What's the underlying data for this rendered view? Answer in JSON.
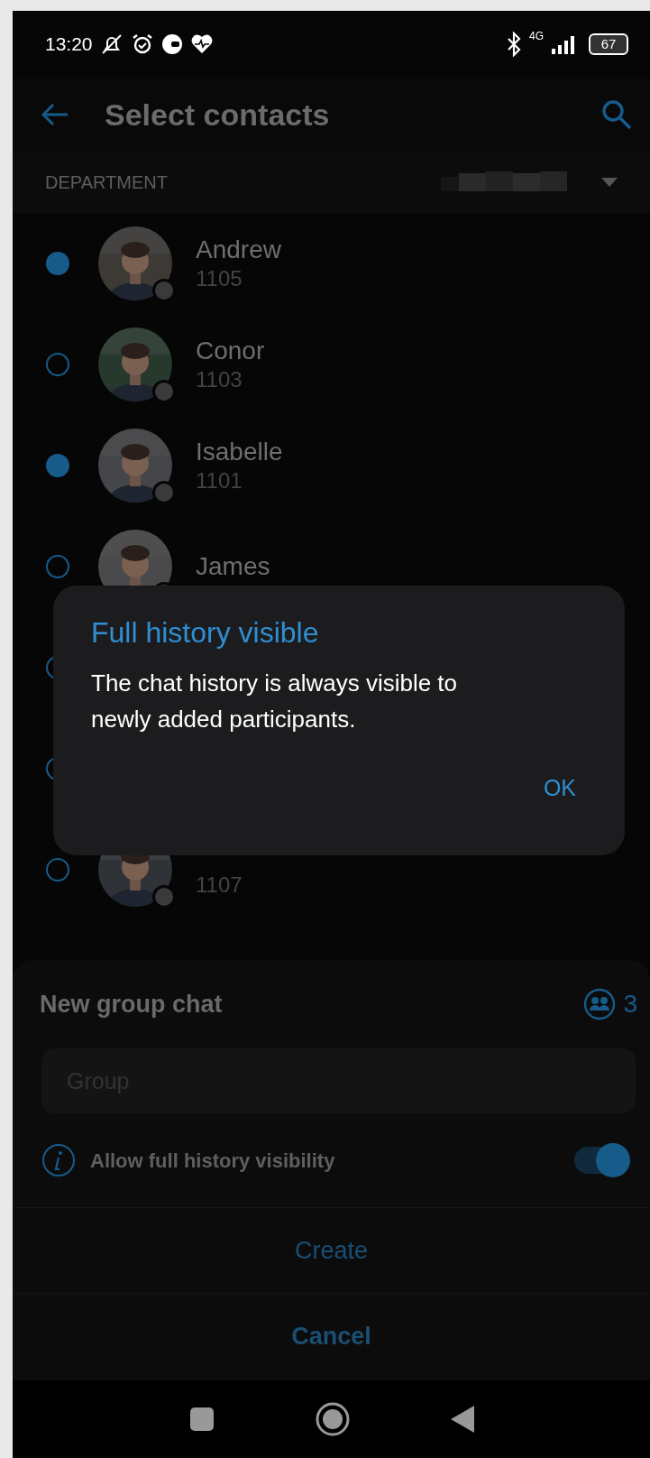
{
  "status_bar": {
    "time": "13:20",
    "network": "4G",
    "battery": "67"
  },
  "header": {
    "title": "Select contacts"
  },
  "filter": {
    "label": "DEPARTMENT"
  },
  "contacts": [
    {
      "name": "Andrew",
      "extension": "1105",
      "selected": true
    },
    {
      "name": "Conor",
      "extension": "1103",
      "selected": false
    },
    {
      "name": "Isabelle",
      "extension": "1101",
      "selected": true
    },
    {
      "name": "James",
      "selected": false
    },
    {
      "selected": false
    },
    {
      "selected": false
    },
    {
      "extension": "1107",
      "selected": false
    }
  ],
  "dialog": {
    "title": "Full history visible",
    "message": "The chat history is always visible to newly added participants.",
    "buttons": [
      "OK"
    ]
  },
  "group_sheet": {
    "title": "New group chat",
    "member_count": "3",
    "name_field": {
      "placeholder": "Group"
    },
    "history_toggle": {
      "label": "Allow full history visibility",
      "on": true
    },
    "buttons": [
      {
        "label": "Create",
        "kind": "plain"
      },
      {
        "label": "Cancel",
        "kind": "bold"
      }
    ]
  }
}
